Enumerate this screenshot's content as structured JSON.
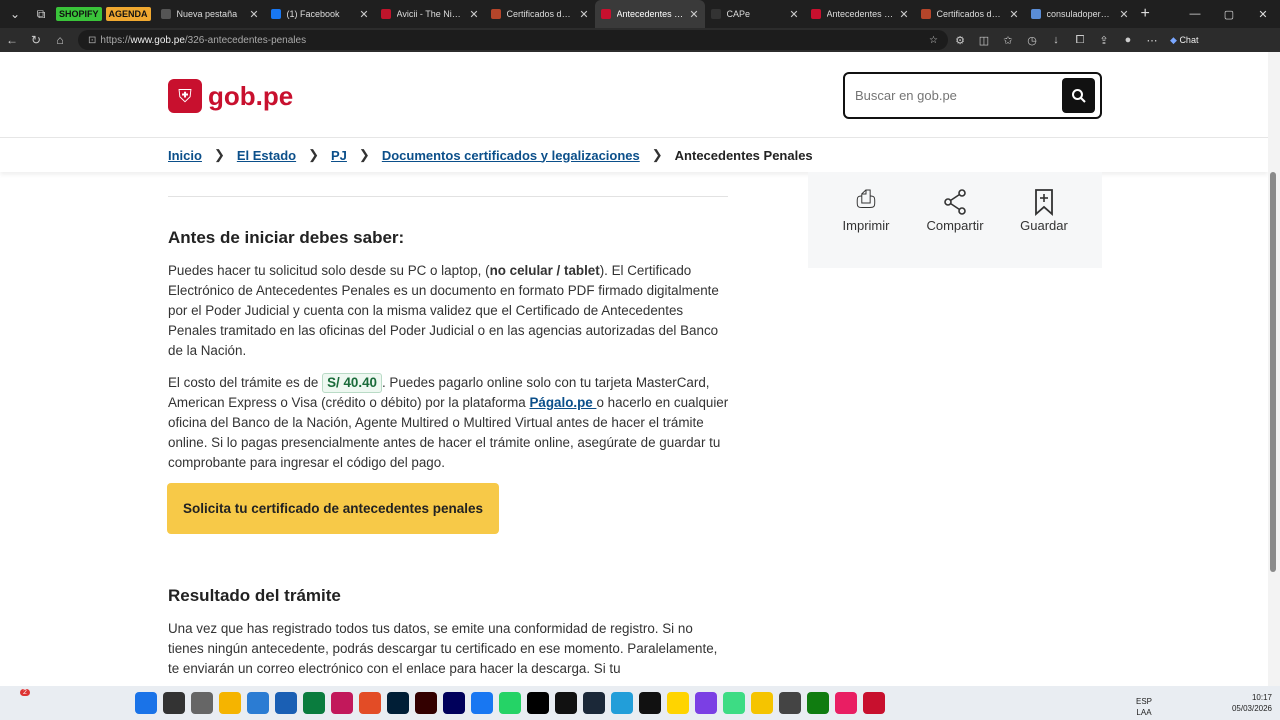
{
  "browser": {
    "pills": [
      "SHOPIFY",
      "AGENDA"
    ],
    "tabs": [
      {
        "label": "Nueva pestaña",
        "color": "#555555"
      },
      {
        "label": "(1) Facebook",
        "color": "#1877f2"
      },
      {
        "label": "Avicii - The Nights |",
        "color": "#c0142b"
      },
      {
        "label": "Certificados de ante",
        "color": "#b5452a"
      },
      {
        "label": "Antecedentes Pe",
        "color": "#c8102e",
        "active": true
      },
      {
        "label": "CAPe",
        "color": "#333333"
      },
      {
        "label": "Antecedentes Penal",
        "color": "#c8102e"
      },
      {
        "label": "Certificados de Ante",
        "color": "#b5452a"
      },
      {
        "label": "consuladoperumad",
        "color": "#5a8dd6"
      }
    ],
    "url_prefix": "https://",
    "url_host": "www.gob.pe",
    "url_path": "/326-antecedentes-penales",
    "chat_label": "Chat"
  },
  "header": {
    "logo_text": "gob.pe",
    "search_placeholder": "Buscar en gob.pe"
  },
  "breadcrumb": {
    "items": [
      "Inicio",
      "El Estado",
      "PJ",
      "Documentos certificados y legalizaciones"
    ],
    "current": "Antecedentes Penales"
  },
  "actions": {
    "print": "Imprimir",
    "share": "Compartir",
    "save": "Guardar"
  },
  "content": {
    "section1_title": "Antes de iniciar debes saber:",
    "p1_a": "Puedes hacer tu solicitud solo desde su PC o laptop, (",
    "p1_bold": "no celular / tablet",
    "p1_b": "). El Certificado Electrónico de Antecedentes Penales es un documento en formato PDF firmado digitalmente por el Poder Judicial y cuenta con la misma validez que el Certificado de Antecedentes Penales tramitado en las oficinas del Poder Judicial o en las agencias autorizadas del Banco de la Nación.",
    "p2_a": "El costo del trámite es de ",
    "price": "S/ 40.40",
    "p2_b": ". Puedes pagarlo online solo con tu tarjeta MasterCard, American Express o Visa (crédito o débito) por la plataforma ",
    "p2_link": "Págalo.pe ",
    "p2_c": "o hacerlo en cualquier oficina del Banco de la Nación, Agente Multired o Multired Virtual antes de hacer el trámite online. Si lo pagas presencialmente antes de hacer el trámite online, asegúrate de guardar tu comprobante para ingresar el código del pago.",
    "cta": "Solicita tu certificado de antecedentes penales",
    "section2_title": "Resultado del trámite",
    "p3": "Una vez que has registrado todos tus datos, se emite una conformidad de registro. Si no tienes ningún antecedente, podrás descargar tu certificado en ese momento. Paralelamente, te enviarán un correo electrónico con el enlace para hacer la descarga. Si tu"
  },
  "tray": {
    "lang": "ESP",
    "layout": "LAA",
    "time": "10:17",
    "date": "05/03/2026",
    "badge": "2"
  }
}
